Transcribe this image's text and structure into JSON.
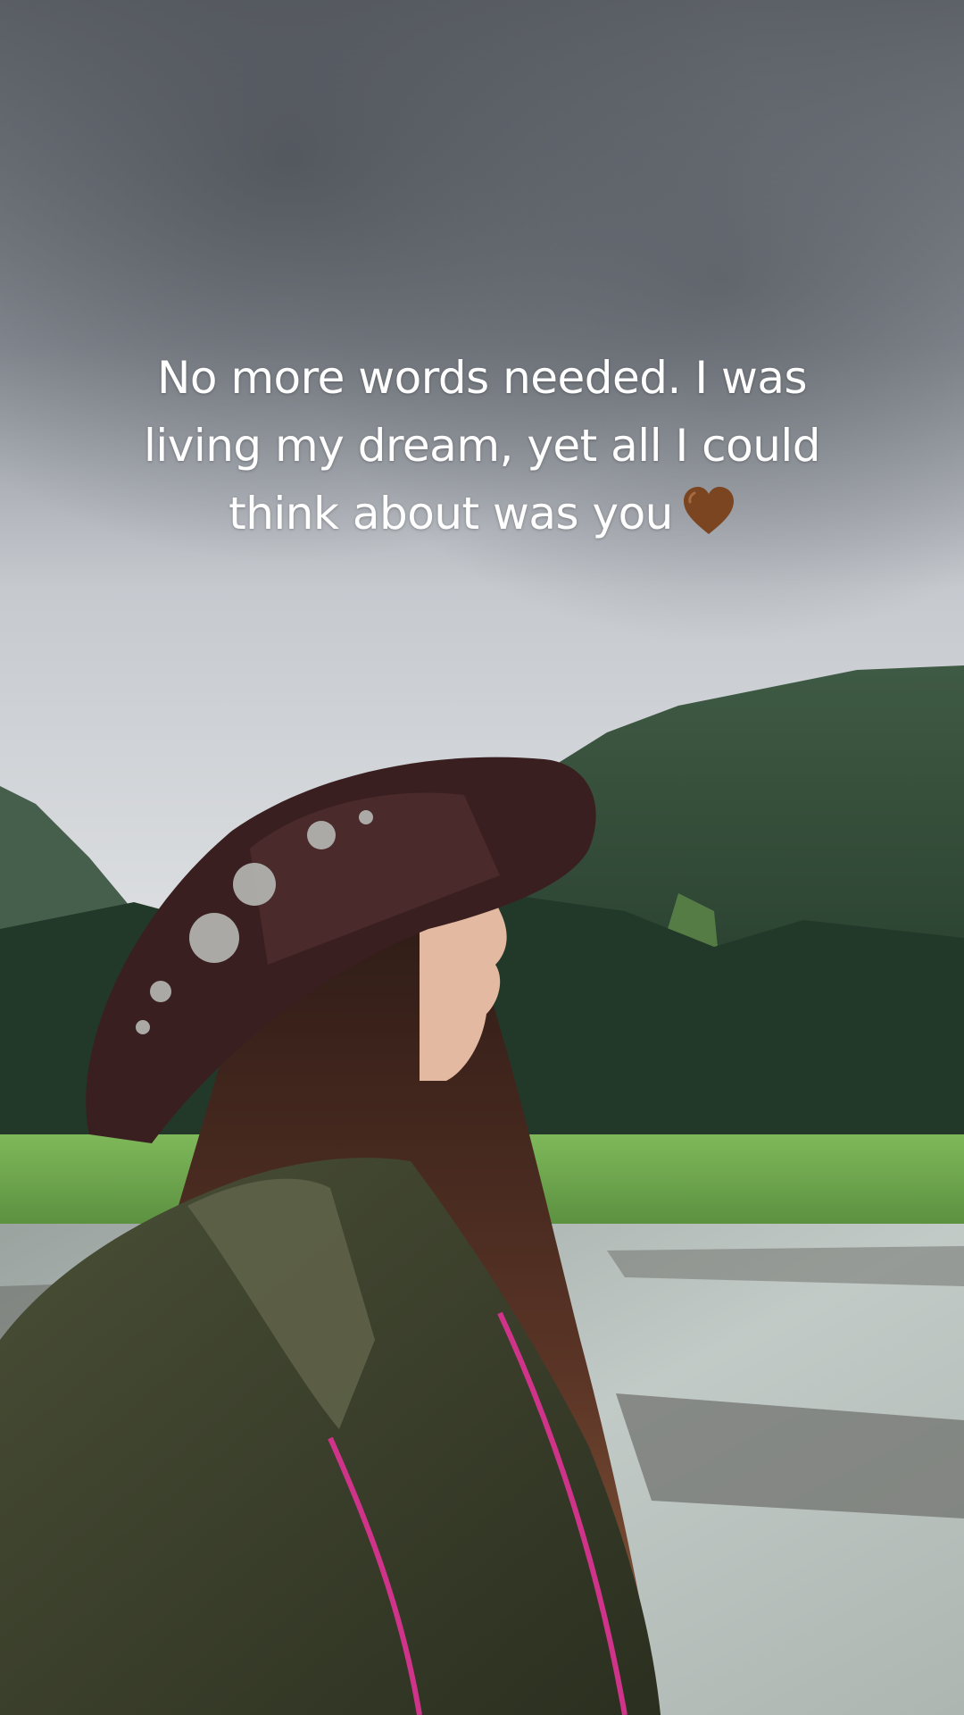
{
  "caption": {
    "lines": [
      "No more words needed. I was",
      "living my dream, yet all I could",
      "think about was you"
    ],
    "emoji": "brown-heart",
    "emoji_color": "#7a4520"
  },
  "scene": {
    "description_icon": "photo-background",
    "sky_color": "#8a8f97",
    "mountain_color": "#2f4a35",
    "meadow_color": "#6ba84a",
    "river_color": "#b8c0be",
    "hat_color": "#3a1f20",
    "jacket_color": "#3b3f2b",
    "hair_color": "#4a2c22",
    "accent_color": "#d0348a"
  }
}
